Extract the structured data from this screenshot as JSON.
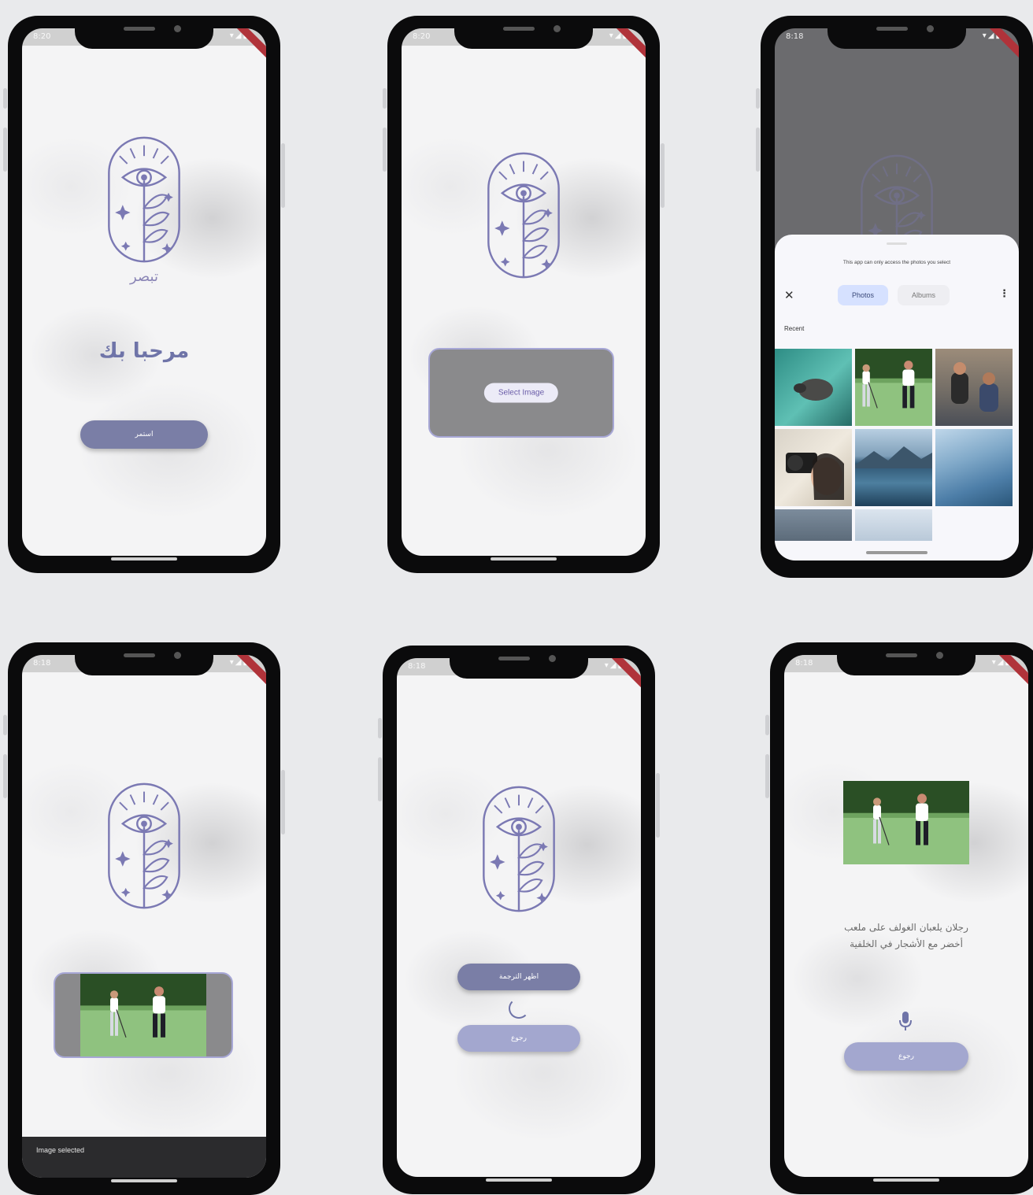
{
  "status_time_a": "8:20",
  "status_time_b": "8:18",
  "screen1": {
    "logo_text": "تبصر",
    "welcome": "مرحبا بك",
    "continue_button": "استمر"
  },
  "screen2": {
    "select_button": "Select Image"
  },
  "screen3": {
    "notice": "This app can only access the photos you select",
    "tab_photos": "Photos",
    "tab_albums": "Albums",
    "section_recent": "Recent"
  },
  "screen4": {
    "snackbar": "Image selected"
  },
  "screen5": {
    "translate_button": "اظهر الترجمة",
    "back_button": "رجوع"
  },
  "screen6": {
    "caption": "رجلان يلعبان الغولف على ملعب أخضر مع الأشجار في الخلفية",
    "back_button": "رجوع"
  },
  "colors": {
    "accent": "#6f74a8",
    "button_dark": "#7a7ea6",
    "button_light": "#a3a7cf",
    "card_border": "#a7a7d6"
  }
}
